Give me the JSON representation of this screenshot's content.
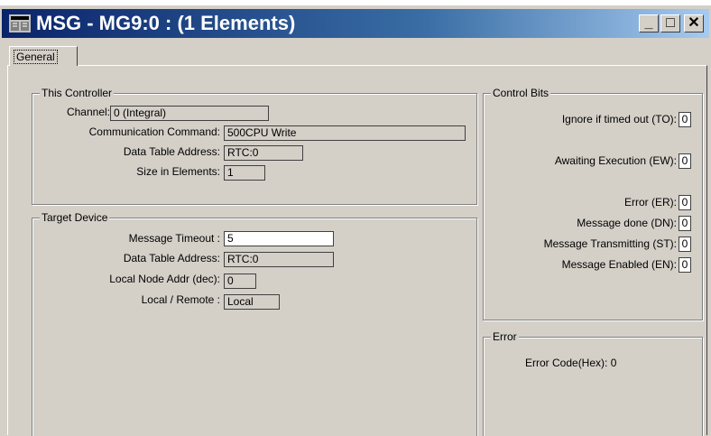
{
  "window": {
    "title": "MSG - MG9:0 : (1 Elements)",
    "min_glyph": "_",
    "max_glyph": "□",
    "close_glyph": "✕"
  },
  "tabs": [
    {
      "label": "General"
    }
  ],
  "this_controller": {
    "legend": "This Controller",
    "channel_label": "Channel:",
    "channel_value": "0 (Integral)",
    "command_label": "Communication Command:",
    "command_value": "500CPU Write",
    "dta_label": "Data Table Address:",
    "dta_value": "RTC:0",
    "size_label": "Size in Elements:",
    "size_value": "1"
  },
  "target_device": {
    "legend": "Target Device",
    "timeout_label": "Message Timeout :",
    "timeout_value": "5",
    "dta_label": "Data Table Address:",
    "dta_value": "RTC:0",
    "node_label": "Local Node Addr (dec):",
    "node_value": "0",
    "lr_label": "Local / Remote :",
    "lr_value": "Local"
  },
  "control_bits": {
    "legend": "Control Bits",
    "to_label": "Ignore if timed out (TO):",
    "to_value": "0",
    "ew_label": "Awaiting Execution (EW):",
    "ew_value": "0",
    "er_label": "Error (ER):",
    "er_value": "0",
    "dn_label": "Message done (DN):",
    "dn_value": "0",
    "st_label": "Message Transmitting (ST):",
    "st_value": "0",
    "en_label": "Message Enabled (EN):",
    "en_value": "0"
  },
  "error": {
    "legend": "Error",
    "code_text": "Error Code(Hex): 0"
  },
  "colors": {
    "titlebar_start": "#0a246a",
    "titlebar_end": "#a6caf0",
    "face": "#d4d0c8"
  }
}
